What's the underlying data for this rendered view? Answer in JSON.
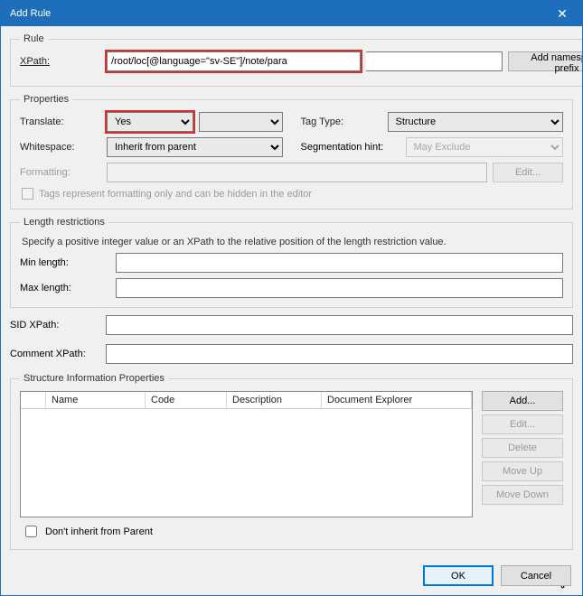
{
  "window": {
    "title": "Add Rule"
  },
  "rule": {
    "legend": "Rule",
    "xpath_label": "XPath:",
    "xpath_value": "/root/loc[@language=\"sv-SE\"]/note/para",
    "add_namespace_label": "Add namespace prefix"
  },
  "properties": {
    "legend": "Properties",
    "translate_label": "Translate:",
    "translate_value": "Yes",
    "tagtype_label": "Tag Type:",
    "tagtype_value": "Structure",
    "whitespace_label": "Whitespace:",
    "whitespace_value": "Inherit from parent",
    "segmentation_label": "Segmentation hint:",
    "segmentation_value": "May Exclude",
    "formatting_label": "Formatting:",
    "edit_label": "Edit...",
    "formatting_hint": "Tags represent formatting only and can be hidden in the editor"
  },
  "length": {
    "legend": "Length restrictions",
    "desc": "Specify a positive integer value or an XPath to the relative position of the length restriction value.",
    "min_label": "Min length:",
    "max_label": "Max length:"
  },
  "sid": {
    "label": "SID XPath:"
  },
  "comment": {
    "label": "Comment XPath:"
  },
  "structure": {
    "legend": "Structure Information Properties",
    "cols": {
      "name": "Name",
      "code": "Code",
      "desc": "Description",
      "docexp": "Document Explorer"
    },
    "btns": {
      "add": "Add...",
      "edit": "Edit...",
      "delete": "Delete",
      "moveup": "Move Up",
      "movedown": "Move Down"
    },
    "inherit_label": "Don't inherit from Parent"
  },
  "footer": {
    "ok": "OK",
    "cancel": "Cancel"
  }
}
